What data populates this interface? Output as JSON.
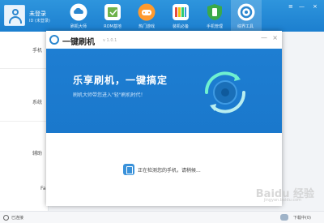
{
  "topbar": {
    "login_name": "未登录",
    "login_sub": "ID (未登录)",
    "nav": [
      {
        "label": "刷机大师",
        "color": "#ffffff",
        "icon": "cloud-icon"
      },
      {
        "label": "ROM基地",
        "color": "#ffffff",
        "icon": "rom-icon"
      },
      {
        "label": "热门游戏",
        "color": "#ff9a2e",
        "icon": "gamepad-icon"
      },
      {
        "label": "装机必备",
        "color": "#ffffff",
        "icon": "apps-icon"
      },
      {
        "label": "手机管理",
        "color": "#3aa94a",
        "icon": "shield-icon"
      },
      {
        "label": "综界工具",
        "color": "#ffffff",
        "icon": "tools-icon"
      }
    ],
    "window_controls": {
      "menu": "≡",
      "minimize": "—",
      "close": "×"
    }
  },
  "sidebar": {
    "items": [
      "手机",
      "系统",
      "辅助",
      "Fa"
    ]
  },
  "modal": {
    "title": "一键刷机",
    "version": "v 1.0.1",
    "minimize": "—",
    "close": "×",
    "hero_title": "乐享刷机，一键搞定",
    "hero_sub": "刷机大师带您进入\"轻\"刷机时代！",
    "detect_text": "正在检测您的手机，请稍候..."
  },
  "statusbar": {
    "left": "已连接",
    "right": "下载中(0)"
  },
  "watermark": {
    "text": "Baidu 经验",
    "sub": "jingyan.baidu.com"
  }
}
